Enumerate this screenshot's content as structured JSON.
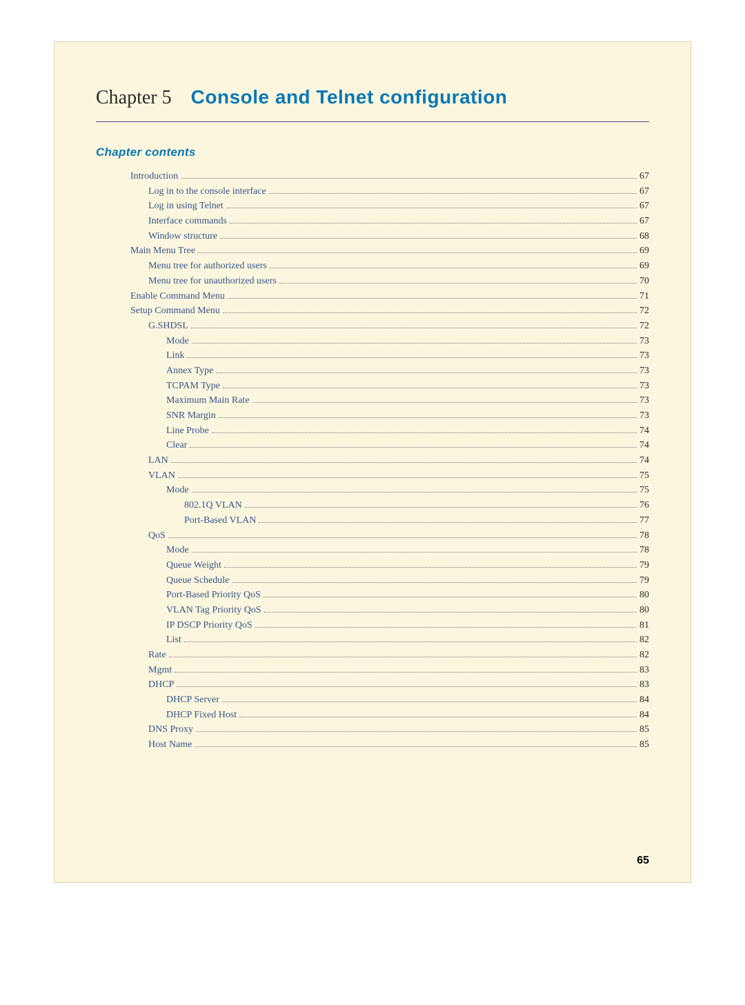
{
  "chapter": {
    "number_label": "Chapter 5",
    "title": "Console and Telnet configuration"
  },
  "contents_heading": "Chapter contents",
  "page_number": "65",
  "toc": [
    {
      "label": "Introduction",
      "page": "67",
      "level": 1
    },
    {
      "label": "Log in to the console interface",
      "page": "67",
      "level": 2
    },
    {
      "label": "Log in using Telnet",
      "page": "67",
      "level": 2
    },
    {
      "label": "Interface commands",
      "page": "67",
      "level": 2
    },
    {
      "label": "Window structure",
      "page": "68",
      "level": 2
    },
    {
      "label": "Main Menu Tree",
      "page": "69",
      "level": 1
    },
    {
      "label": "Menu tree for authorized users",
      "page": "69",
      "level": 2
    },
    {
      "label": "Menu tree for unauthorized users",
      "page": "70",
      "level": 2
    },
    {
      "label": "Enable Command Menu",
      "page": "71",
      "level": 1
    },
    {
      "label": "Setup Command Menu",
      "page": "72",
      "level": 1
    },
    {
      "label": "G.SHDSL",
      "page": "72",
      "level": 2
    },
    {
      "label": "Mode",
      "page": "73",
      "level": 3
    },
    {
      "label": "Link",
      "page": "73",
      "level": 3
    },
    {
      "label": "Annex Type",
      "page": "73",
      "level": 3
    },
    {
      "label": "TCPAM Type",
      "page": "73",
      "level": 3
    },
    {
      "label": "Maximum Main Rate",
      "page": "73",
      "level": 3
    },
    {
      "label": "SNR Margin",
      "page": "73",
      "level": 3
    },
    {
      "label": "Line Probe",
      "page": "74",
      "level": 3
    },
    {
      "label": "Clear",
      "page": "74",
      "level": 3
    },
    {
      "label": "LAN",
      "page": "74",
      "level": 2
    },
    {
      "label": "VLAN",
      "page": "75",
      "level": 2
    },
    {
      "label": "Mode",
      "page": "75",
      "level": 3
    },
    {
      "label": "802.1Q VLAN",
      "page": "76",
      "level": 4
    },
    {
      "label": "Port-Based VLAN",
      "page": "77",
      "level": 4
    },
    {
      "label": "QoS",
      "page": "78",
      "level": 2
    },
    {
      "label": "Mode",
      "page": "78",
      "level": 3
    },
    {
      "label": "Queue Weight",
      "page": "79",
      "level": 3
    },
    {
      "label": "Queue Schedule",
      "page": "79",
      "level": 3
    },
    {
      "label": "Port-Based Priority QoS",
      "page": "80",
      "level": 3
    },
    {
      "label": "VLAN Tag Priority QoS",
      "page": "80",
      "level": 3
    },
    {
      "label": "IP DSCP Priority QoS",
      "page": "81",
      "level": 3
    },
    {
      "label": "List",
      "page": "82",
      "level": 3
    },
    {
      "label": "Rate",
      "page": "82",
      "level": 2
    },
    {
      "label": "Mgmt",
      "page": "83",
      "level": 2
    },
    {
      "label": "DHCP",
      "page": "83",
      "level": 2
    },
    {
      "label": "DHCP Server",
      "page": "84",
      "level": 3
    },
    {
      "label": "DHCP Fixed Host",
      "page": "84",
      "level": 3
    },
    {
      "label": "DNS Proxy",
      "page": "85",
      "level": 2
    },
    {
      "label": "Host Name",
      "page": "85",
      "level": 2
    }
  ]
}
